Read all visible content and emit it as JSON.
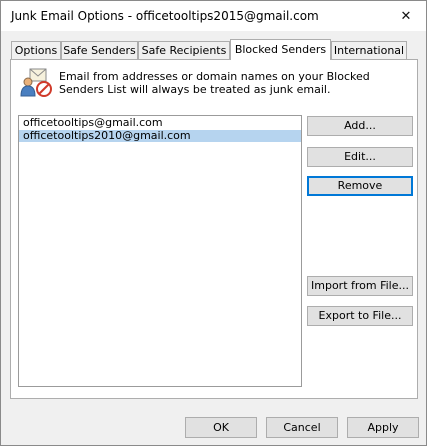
{
  "window": {
    "title": "Junk Email Options - officetooltips2015@gmail.com",
    "close_glyph": "✕"
  },
  "tabs": [
    {
      "label": "Options"
    },
    {
      "label": "Safe Senders"
    },
    {
      "label": "Safe Recipients"
    },
    {
      "label": "Blocked Senders",
      "active": true
    },
    {
      "label": "International"
    }
  ],
  "panel": {
    "description": "Email from addresses or domain names on your Blocked Senders List will always be treated as junk email.",
    "icon": "blocked-senders-icon",
    "list": [
      {
        "address": "officetooltips@gmail.com",
        "selected": false
      },
      {
        "address": "officetooltips2010@gmail.com",
        "selected": true
      }
    ],
    "buttons": {
      "add": "Add...",
      "edit": "Edit...",
      "remove": "Remove",
      "import": "Import from File...",
      "export": "Export to File..."
    }
  },
  "footer": {
    "ok": "OK",
    "cancel": "Cancel",
    "apply": "Apply"
  },
  "colors": {
    "selection": "#b6d4ef",
    "focus_border": "#0078d7",
    "dialog_bg": "#f0f0f0"
  }
}
